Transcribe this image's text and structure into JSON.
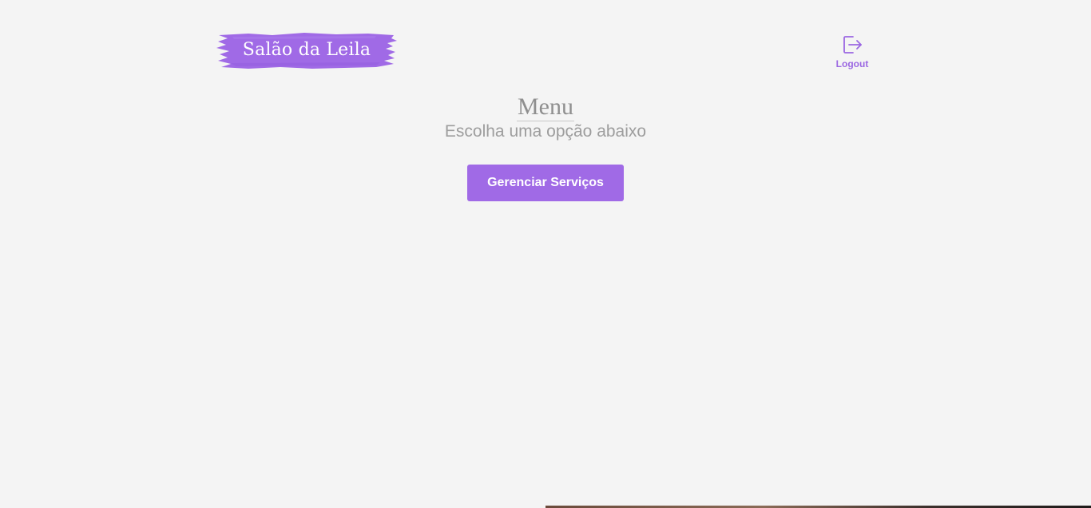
{
  "brand": {
    "name": "Salão da Leila",
    "brush_color": "#a06ae6"
  },
  "header": {
    "logout_label": "Logout",
    "logout_icon": "logout-icon"
  },
  "main": {
    "title": "Menu",
    "subtitle": "Escolha uma opção abaixo",
    "buttons": [
      {
        "label": "Gerenciar Serviços"
      }
    ]
  },
  "colors": {
    "accent": "#a06ae6",
    "background": "#f4f4f4",
    "muted_text": "#9d9d9d"
  }
}
